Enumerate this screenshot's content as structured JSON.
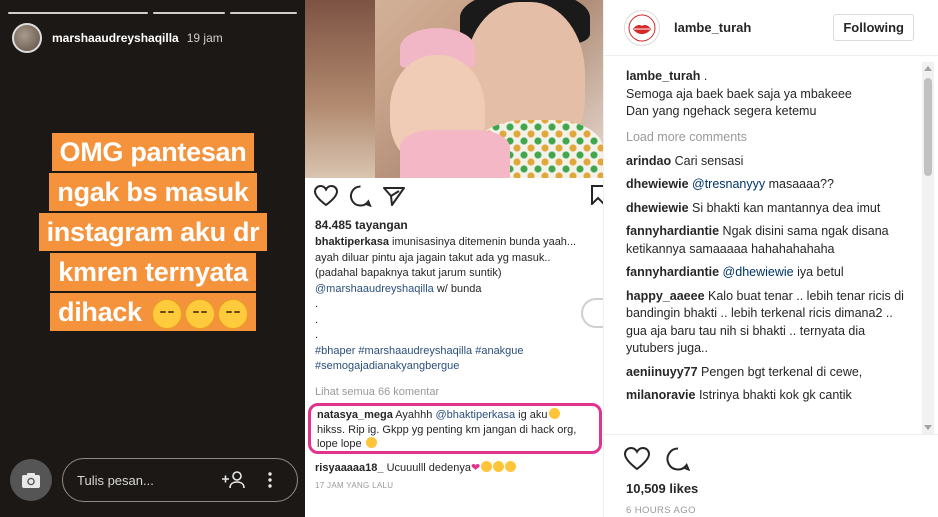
{
  "story": {
    "username": "marshaaudreyshaqilla",
    "time": "19 jam",
    "lines": [
      "OMG pantesan",
      "ngak bs masuk",
      "instagram aku  dr",
      "kmren ternyata",
      "dihack"
    ],
    "message_placeholder": "Tulis pesan...",
    "icons": [
      "camera-icon",
      "add-person-icon",
      "more-vertical-icon"
    ]
  },
  "phone": {
    "views": "84.485 tayangan",
    "caption": {
      "user": "bhaktiperkasa",
      "text1": " imunisasinya ditemenin bunda yaah... ayah diluar pintu aja jagain takut ada yg masuk.. (padahal bapaknya takut jarum suntik)",
      "mention": "@marshaaudreyshaqilla",
      "text2": " w/ bunda",
      "dots": [
        ".",
        ".",
        "."
      ],
      "tags": "#bhaper #marshaaudreyshaqilla #anakgue #semogajadianakyangbergue"
    },
    "see_all": "Lihat semua 66 komentar",
    "highlight_comment": {
      "user": "natasya_mega",
      "text1": " Ayahhh ",
      "mention": "@bhaktiperkasa",
      "text2": "  ig aku",
      "text3": " hikss. Rip ig. Gkpp yg penting km jangan di hack org, lope lope "
    },
    "comment2": {
      "user": "risyaaaaa18_",
      "text": " Ucuuulll dedenya"
    },
    "time": "17 JAM YANG LALU"
  },
  "post": {
    "username": "lambe_turah",
    "follow_label": "Following",
    "caption_user": "lambe_turah",
    "caption_lines": [
      " .",
      "Semoga aja baek baek saja ya mbakeee",
      "Dan yang ngehack segera ketemu"
    ],
    "load_more": "Load more comments",
    "comments": [
      {
        "user": "arindao",
        "text": " Cari sensasi"
      },
      {
        "user": "dhewiewie",
        "mention": " @tresnanyyy",
        "text": " masaaaa??"
      },
      {
        "user": "dhewiewie",
        "text": " Si bhakti kan mantannya dea imut"
      },
      {
        "user": "fannyhardiantie",
        "text": " Ngak disini sama ngak disana ketikannya samaaaaa hahahahahaha"
      },
      {
        "user": "fannyhardiantie",
        "mention": " @dhewiewie",
        "text": " iya betul"
      },
      {
        "user": "happy_aaeee",
        "text": " Kalo buat tenar .. lebih tenar ricis di bandingin bhakti .. lebih terkenal ricis dimana2 .. gua aja baru tau nih si bhakti .. ternyata dia yutubers juga.."
      },
      {
        "user": "aeniinuyy77",
        "text": " Pengen bgt terkenal di cewe,"
      },
      {
        "user": "milanoravie",
        "text": " Istrinya bhakti kok gk cantik"
      }
    ],
    "likes": "10,509 likes",
    "time": "6 HOURS AGO"
  }
}
